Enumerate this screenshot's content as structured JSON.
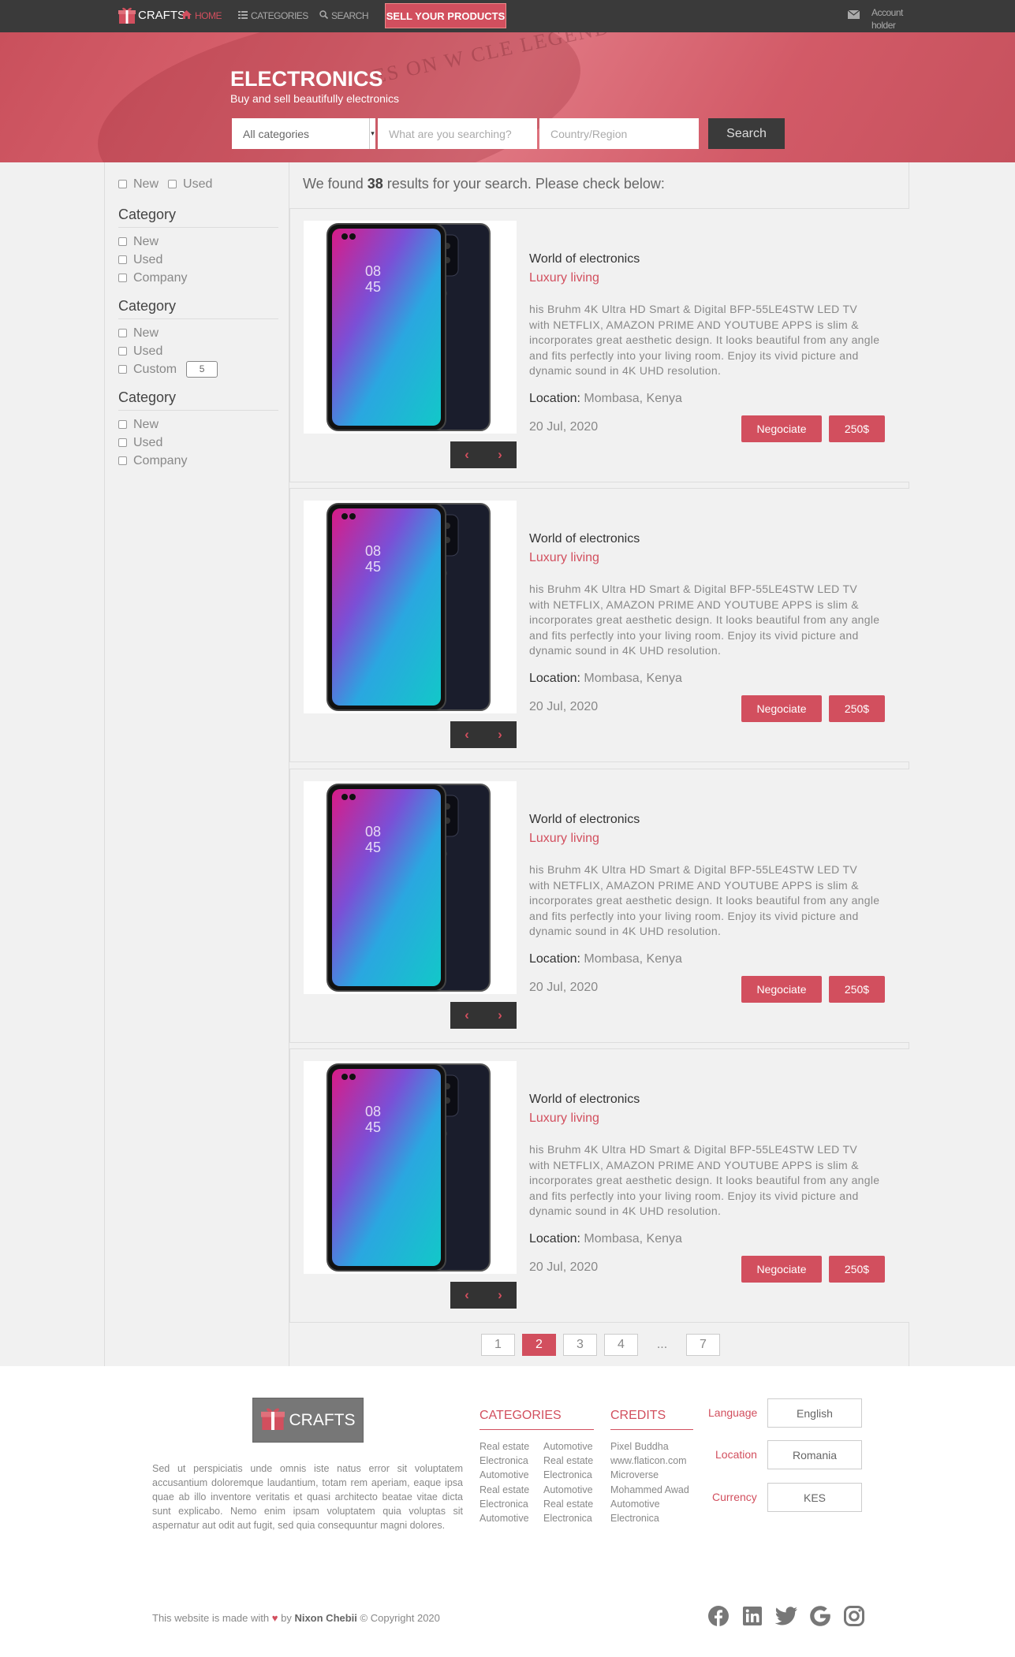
{
  "nav": {
    "brand": "CRAFTS",
    "home": "HOME",
    "categories": "CATEGORIES",
    "search": "SEARCH",
    "sell": "SELL YOUR PRODUCTS",
    "account_line1": "Account",
    "account_line2": "holder"
  },
  "hero": {
    "title": "ELECTRONICS",
    "subtitle": "Buy and sell beautifully electronics",
    "category_select": "All categories",
    "search_placeholder": "What are you searching?",
    "region_placeholder": "Country/Region",
    "search_button": "Search"
  },
  "sidebar": {
    "top_new": "New",
    "top_used": "Used",
    "groups": [
      {
        "title": "Category",
        "items": [
          "New",
          "Used",
          "Company"
        ]
      },
      {
        "title": "Category",
        "items": [
          "New",
          "Used",
          "Custom"
        ],
        "custom_value": "5"
      },
      {
        "title": "Category",
        "items": [
          "New",
          "Used",
          "Company"
        ]
      }
    ]
  },
  "results": {
    "prefix": "We found ",
    "count": "38",
    "suffix": " results for your search. Please check below:"
  },
  "listings": [
    {
      "shop": "World of electronics",
      "tag": "Luxury living",
      "description": "his Bruhm 4K Ultra HD Smart & Digital BFP-55LE4STW LED TV with NETFLIX, AMAZON PRIME AND YOUTUBE APPS is slim & incorporates great aesthetic design. It looks beautiful from any angle and fits perfectly into your living room. Enjoy its vivid picture and dynamic sound in 4K UHD resolution.",
      "location_label": "Location:",
      "location": "Mombasa, Kenya",
      "date": "20 Jul, 2020",
      "negotiate": "Negociate",
      "price": "250$"
    },
    {
      "shop": "World of electronics",
      "tag": "Luxury living",
      "description": "his Bruhm 4K Ultra HD Smart & Digital BFP-55LE4STW LED TV with NETFLIX, AMAZON PRIME AND YOUTUBE APPS is slim & incorporates great aesthetic design. It looks beautiful from any angle and fits perfectly into your living room. Enjoy its vivid picture and dynamic sound in 4K UHD resolution.",
      "location_label": "Location:",
      "location": "Mombasa, Kenya",
      "date": "20 Jul, 2020",
      "negotiate": "Negociate",
      "price": "250$"
    },
    {
      "shop": "World of electronics",
      "tag": "Luxury living",
      "description": "his Bruhm 4K Ultra HD Smart & Digital BFP-55LE4STW LED TV with NETFLIX, AMAZON PRIME AND YOUTUBE APPS is slim & incorporates great aesthetic design. It looks beautiful from any angle and fits perfectly into your living room. Enjoy its vivid picture and dynamic sound in 4K UHD resolution.",
      "location_label": "Location:",
      "location": "Mombasa, Kenya",
      "date": "20 Jul, 2020",
      "negotiate": "Negociate",
      "price": "250$"
    },
    {
      "shop": "World of electronics",
      "tag": "Luxury living",
      "description": "his Bruhm 4K Ultra HD Smart & Digital BFP-55LE4STW LED TV with NETFLIX, AMAZON PRIME AND YOUTUBE APPS is slim & incorporates great aesthetic design. It looks beautiful from any angle and fits perfectly into your living room. Enjoy its vivid picture and dynamic sound in 4K UHD resolution.",
      "location_label": "Location:",
      "location": "Mombasa, Kenya",
      "date": "20 Jul, 2020",
      "negotiate": "Negociate",
      "price": "250$"
    }
  ],
  "pager": {
    "pages": [
      "1",
      "2",
      "3",
      "4",
      "...",
      "7"
    ],
    "current": "2"
  },
  "footer": {
    "brand": "CRAFTS",
    "paragraph": "Sed ut perspiciatis unde omnis iste natus error sit voluptatem accusantium doloremque laudantium, totam rem aperiam, eaque ipsa quae ab illo inventore veritatis et quasi architecto beatae vitae dicta sunt explicabo. Nemo enim ipsam voluptatem quia voluptas sit aspernatur aut odit aut fugit, sed quia consequuntur magni dolores.",
    "categories_title": "CATEGORIES",
    "categories_col1": [
      "Real estate",
      "Electronica",
      "Automotive",
      "Real estate",
      "Electronica",
      "Automotive"
    ],
    "categories_col2": [
      "Automotive",
      "Real estate",
      "Electronica",
      "Automotive",
      "Real estate",
      "Electronica"
    ],
    "credits_title": "CREDITS",
    "credits": [
      "Pixel Buddha",
      "www.flaticon.com",
      "Microverse",
      "Mohammed Awad",
      "Automotive",
      "Electronica"
    ],
    "language_label": "Language",
    "language": "English",
    "location_label": "Location",
    "location": "Romania",
    "currency_label": "Currency",
    "currency": "KES",
    "copy_prefix": "This website is made with",
    "copy_by": "by",
    "copy_author": "Nixon Chebii",
    "copy_suffix": "© Copyright 2020"
  },
  "colors": {
    "accent": "#d24f5e",
    "nav": "#3a3a3a"
  },
  "icons": [
    "gift-icon",
    "home-icon",
    "list-icon",
    "search-icon",
    "envelope-icon",
    "chevron-left-icon",
    "chevron-right-icon",
    "heart-icon",
    "facebook-icon",
    "linkedin-icon",
    "twitter-icon",
    "google-icon",
    "instagram-icon"
  ]
}
